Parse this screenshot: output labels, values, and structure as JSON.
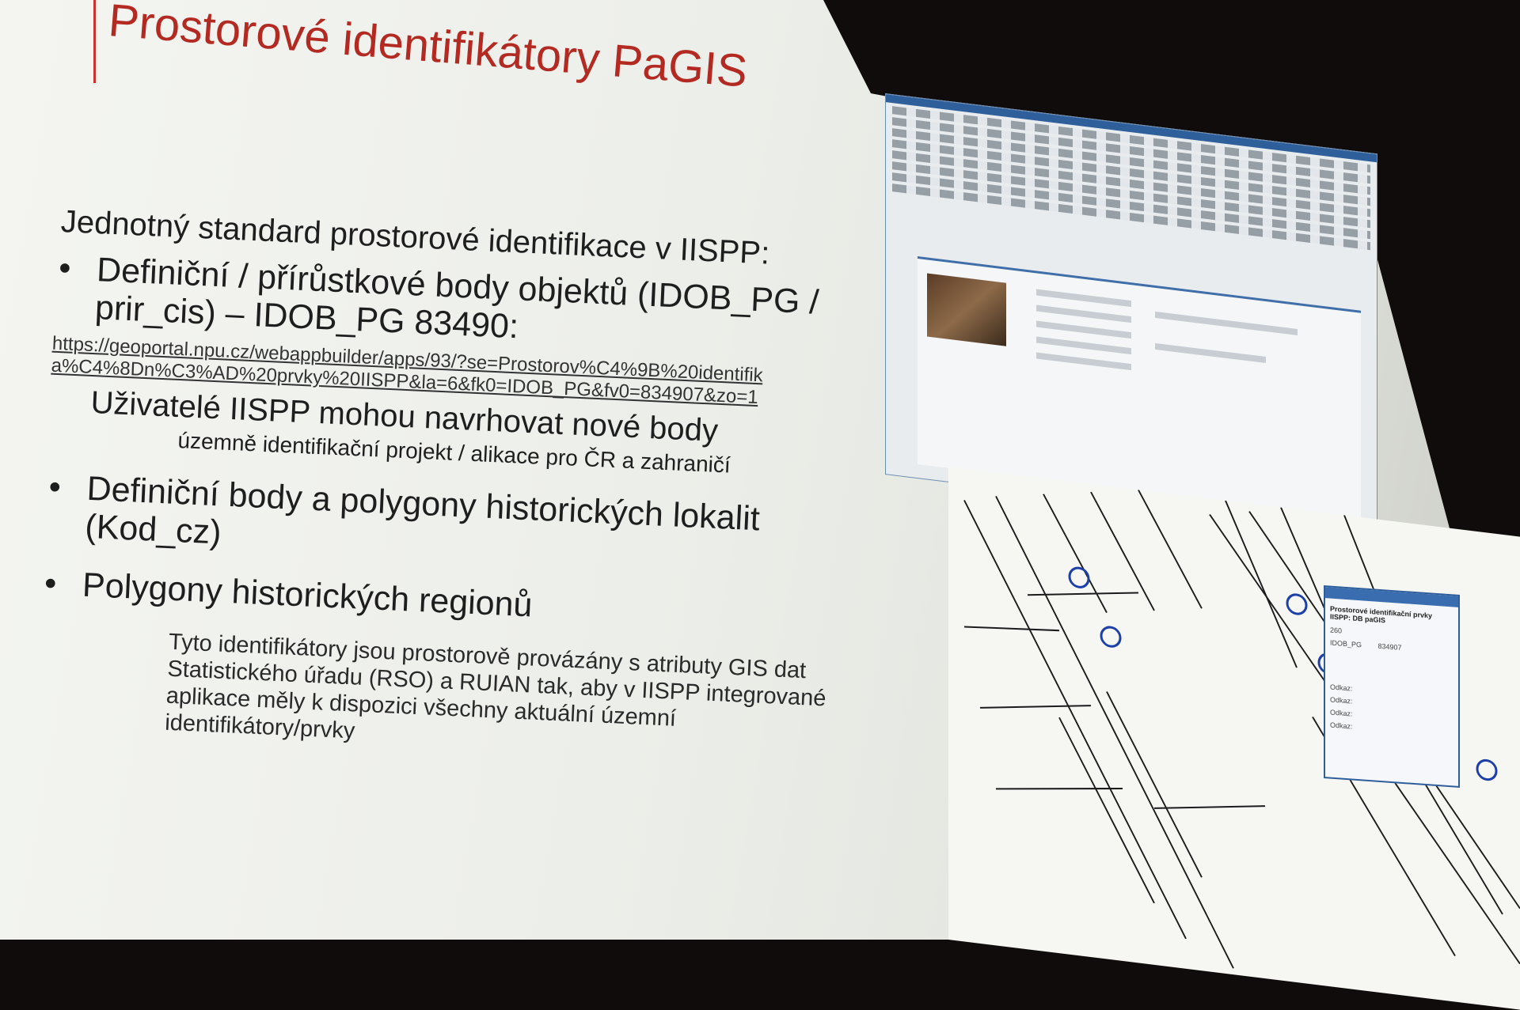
{
  "slide": {
    "title": "Prostorové identifikátory PaGIS",
    "lead": "Jednotný standard prostorové identifikace v IISPP:",
    "bullet1_line1": "Definiční / přírůstkové body objektů (IDOB_PG /",
    "bullet1_line2": "prir_cis) – IDOB_PG 83490:",
    "link_line1": "https://geoportal.npu.cz/webappbuilder/apps/93/?se=Prostorov%C4%9B%20identifik",
    "link_line2": "a%C4%8Dn%C3%AD%20prvky%20IISPP&la=6&fk0=IDOB_PG&fv0=834907&zo=1",
    "sub1": "Uživatelé IISPP mohou navrhovat nové body",
    "sub1_detail": "územně identifikační projekt / alikace pro ČR a zahraničí",
    "bullet2_line1": "Definiční body a polygony historických lokalit",
    "bullet2_line2": "(Kod_cz)",
    "bullet3": "Polygony historických regionů",
    "note_line1": "Tyto identifikátory jsou prostorově provázány s atributy GIS dat",
    "note_line2": "Statistického úřadu (RSO) a RUIAN tak, aby v IISPP integrované",
    "note_line3": "aplikace měly k dispozici všechny aktuální územní",
    "note_line4": "identifikátory/prvky"
  },
  "popup": {
    "title": "Prostorové identifikační prvky IISPP: DB paGIS",
    "value_1": "260",
    "label_2": "IDOB_PG",
    "value_2": "834907",
    "links": [
      "Odkaz:",
      "Odkaz:",
      "Odkaz:",
      "Odkaz:"
    ]
  },
  "colors": {
    "title": "#b32a22",
    "accent": "#2f5f9a"
  }
}
